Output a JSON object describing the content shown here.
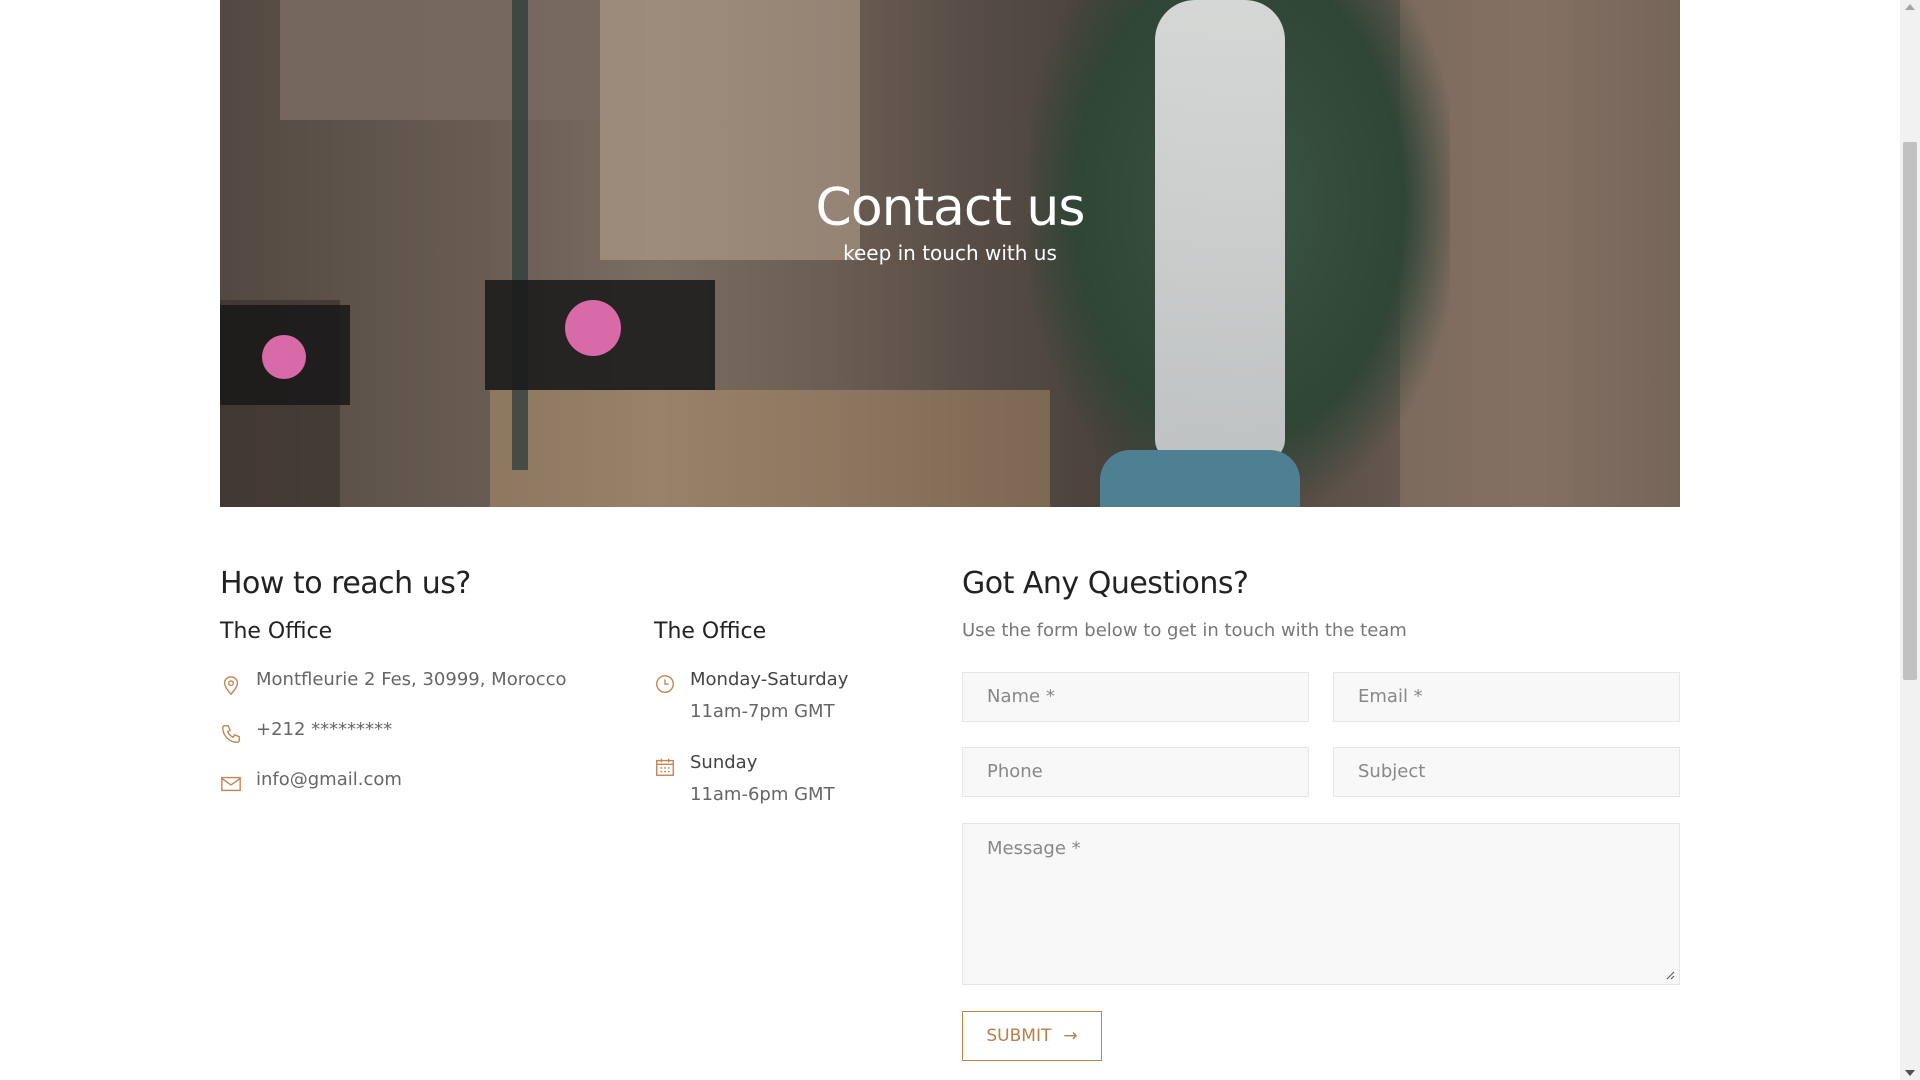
{
  "hero": {
    "title": "Contact us",
    "subtitle": "keep in touch with us"
  },
  "reach": {
    "heading": "How to reach us?",
    "office_left": {
      "title": "The Office",
      "address": "Montfleurie 2 Fes, 30999, Morocco",
      "phone": "+212 *********",
      "email": "info@gmail.com"
    },
    "office_right": {
      "title": "The Office",
      "weekday_label": "Monday-Saturday",
      "weekday_hours": "11am-7pm GMT",
      "sunday_label": "Sunday",
      "sunday_hours": "11am-6pm GMT"
    }
  },
  "form": {
    "heading": "Got Any Questions?",
    "description": "Use the form below to get in touch with the team",
    "name_placeholder": "Name *",
    "email_placeholder": "Email *",
    "phone_placeholder": "Phone",
    "subject_placeholder": "Subject",
    "message_placeholder": "Message *",
    "submit_label": "SUBMIT",
    "submit_arrow": "→"
  },
  "colors": {
    "accent": "#c08552",
    "heading": "#222222",
    "text": "#666666"
  },
  "icons": [
    "map-pin-icon",
    "phone-icon",
    "mail-icon",
    "clock-icon",
    "calendar-icon",
    "arrow-right-icon"
  ]
}
